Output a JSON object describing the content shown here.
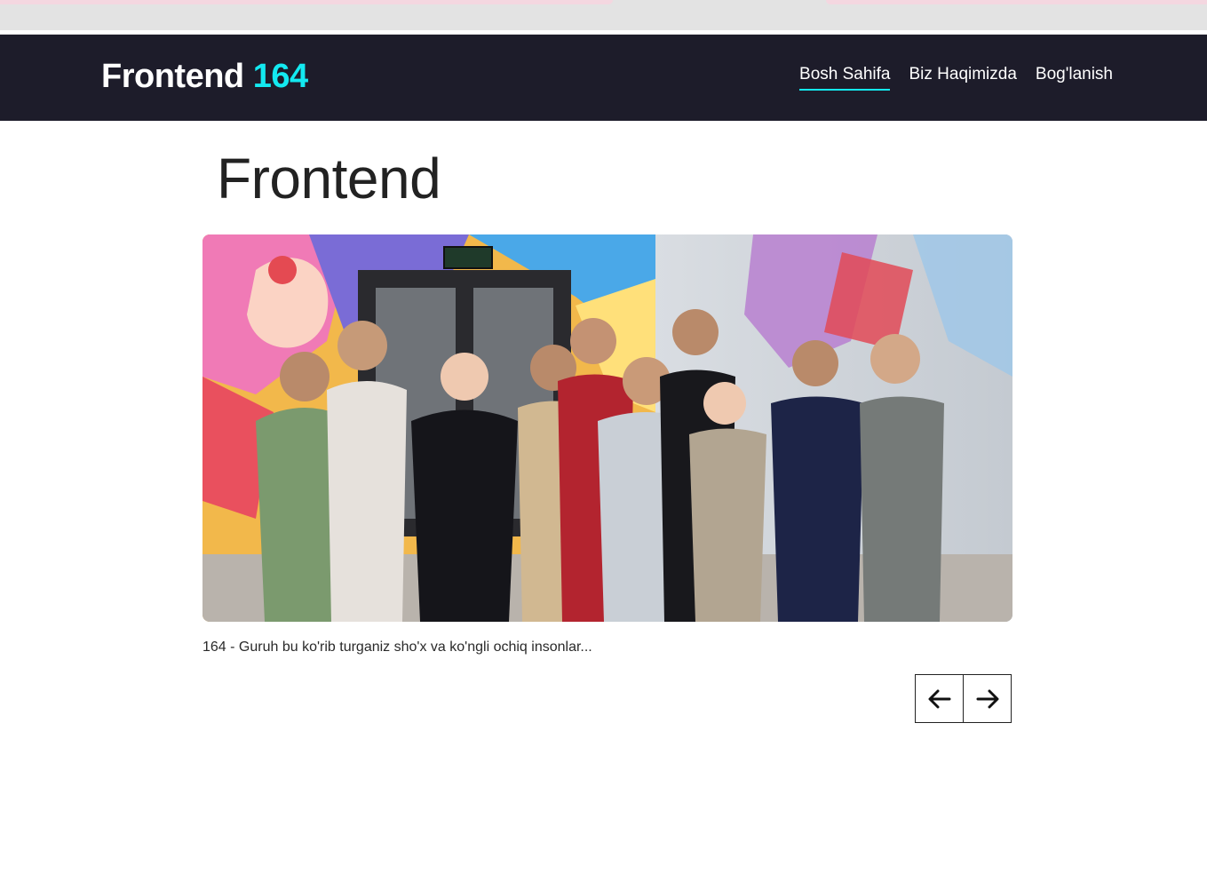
{
  "header": {
    "brand_main": "Frontend",
    "brand_accent": "164",
    "nav": [
      {
        "label": "Bosh Sahifa",
        "active": true
      },
      {
        "label": "Biz Haqimizda",
        "active": false
      },
      {
        "label": "Bog'lanish",
        "active": false
      }
    ]
  },
  "main": {
    "title": "Frontend",
    "slide": {
      "image_alt": "Group photo of 164 group students",
      "caption": "164 - Guruh bu ko'rib turganiz sho'x va ko'ngli ochiq insonlar..."
    },
    "controls": {
      "prev_icon": "arrow-left-icon",
      "next_icon": "arrow-right-icon"
    }
  },
  "colors": {
    "navbar_bg": "#1d1c2a",
    "accent": "#13e9f0"
  }
}
